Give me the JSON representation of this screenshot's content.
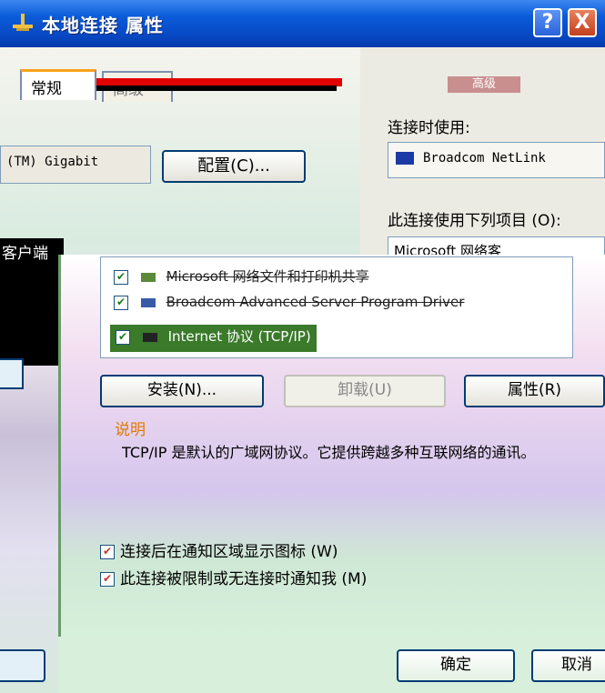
{
  "window": {
    "title": "本地连接 属性",
    "help_label": "?",
    "close_label": "X"
  },
  "tabs": [
    {
      "label": "常规"
    },
    {
      "label": "高级"
    }
  ],
  "back_window": {
    "adapter_text": "(TM) Gigabit",
    "configure_label": "配置(C)...",
    "left_label": "客户端"
  },
  "right_window": {
    "advanced_label": "高级",
    "connect_using_label": "连接时使用:",
    "adapter_name": "Broadcom NetLink",
    "items_label": "此连接使用下列项目 (O):",
    "list_fragment": "Microsoft 网络客"
  },
  "items": [
    {
      "label": "Microsoft 网络文件和打印机共享",
      "checked": true
    },
    {
      "label": "Broadcom Advanced Server Program Driver",
      "checked": true
    },
    {
      "label": "Internet 协议 (TCP/IP)",
      "checked": true
    }
  ],
  "buttons": {
    "install": "安装(N)...",
    "uninstall": "卸载(U)",
    "properties": "属性(R)",
    "ok": "确定",
    "cancel": "取消"
  },
  "description": {
    "title": "说明",
    "text": "TCP/IP 是默认的广域网协议。它提供跨越多种互联网络的通讯。"
  },
  "checkboxes": [
    {
      "label": "连接后在通知区域显示图标 (W)",
      "checked": true
    },
    {
      "label": "此连接被限制或无连接时通知我 (M)",
      "checked": true
    }
  ],
  "colors": {
    "titlebar": "#0848c4",
    "accent_orange": "#e07a00",
    "selected_item": "#3a7a2a"
  }
}
